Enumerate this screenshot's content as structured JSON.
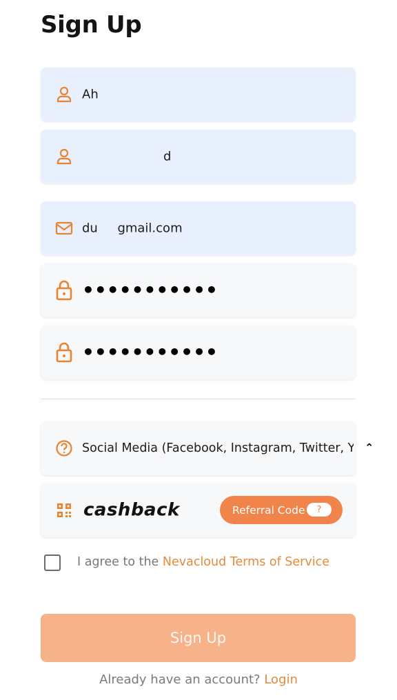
{
  "page": {
    "title": "Sign Up"
  },
  "form": {
    "first_name": "Ah",
    "last_name": "d",
    "email": "du     gmail.com",
    "password": "•••••••••••",
    "confirm_password": "•••••••••••",
    "heard_from": "Social Media (Facebook, Instagram, Twitter, Yo",
    "promo_image_text": "cashback",
    "referral_label": "Referral Code",
    "referral_help": "?",
    "agree_prefix": "I agree to the ",
    "agree_link": "Nevacloud Terms of Service",
    "submit_label": "Sign Up"
  },
  "footer": {
    "prompt": "Already have an account? ",
    "login_link": "Login"
  },
  "icons": {
    "first_name": "user-icon",
    "last_name": "user-icon",
    "email": "envelope-icon",
    "password": "lock-icon",
    "confirm_password": "lock-icon",
    "heard_from": "question-circle-icon",
    "referral": "qr-code-icon",
    "select_caret": "chevron-up-icon"
  },
  "colors": {
    "accent": "#e8832f",
    "filled_field": "#e8f0fe",
    "empty_field": "#f7f8fa",
    "button": "#f6b389",
    "referral_button": "#f0844a"
  }
}
